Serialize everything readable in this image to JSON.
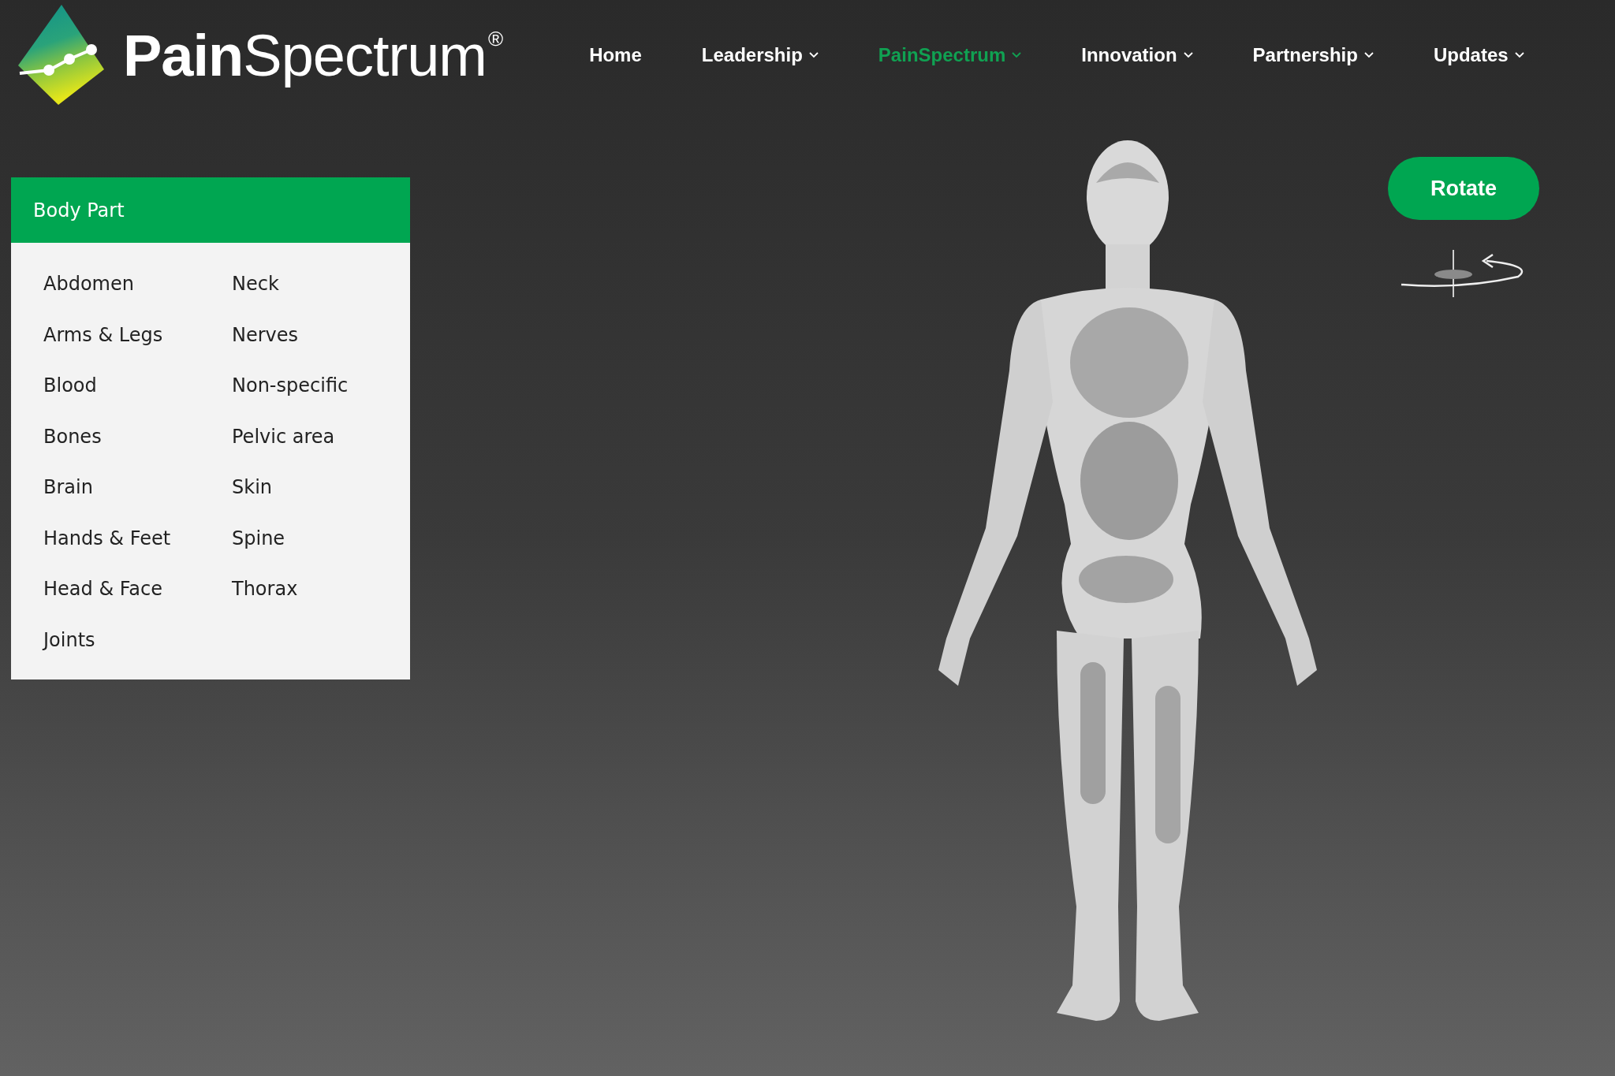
{
  "logo": {
    "text": "**Pain**Spectrum$^{®}$"
  },
  "nav": [
    {
      "label": "Home",
      "dropdown": false,
      "selected": false
    },
    {
      "label": "Leadership",
      "dropdown": true,
      "selected": false
    },
    {
      "label": "PainSpectrum",
      "dropdown": true,
      "selected": true
    },
    {
      "label": "Innovation",
      "dropdown": true,
      "selected": false
    },
    {
      "label": "Partnership",
      "dropdown": true,
      "selected": false
    },
    {
      "label": "Updates",
      "dropdown": true,
      "selected": false
    }
  ],
  "body_part_panel": {
    "title": "Body Part",
    "items": [
      "Abdomen",
      "Arms & Legs",
      "Blood",
      "Bones",
      "Brain",
      "Hands & Feet",
      "Head & Face",
      "Joints",
      "Neck",
      "Nerves",
      "Non-specific",
      "Pelvic area",
      "Skin",
      "Spine",
      "Thorax"
    ]
  },
  "rotate_button": {
    "label": "Rotate"
  }
}
